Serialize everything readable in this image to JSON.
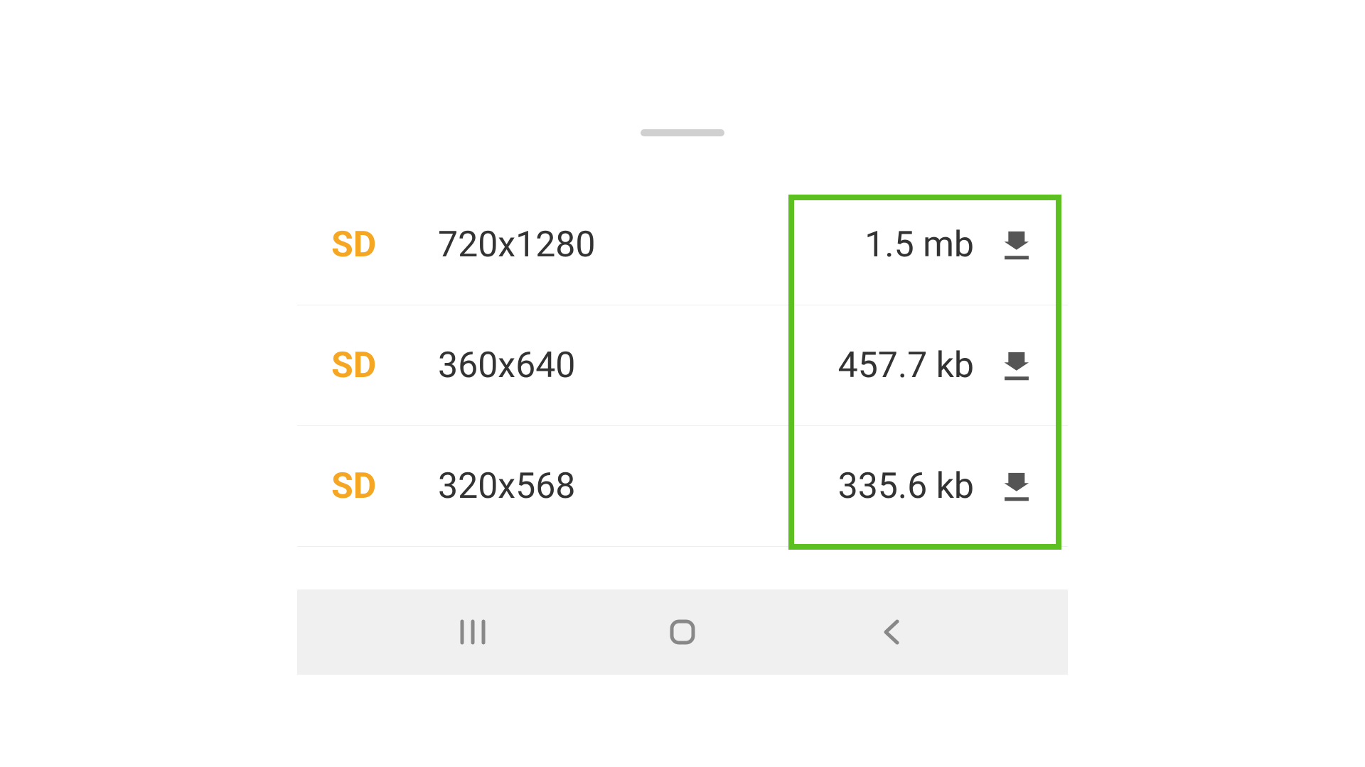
{
  "colors": {
    "badge": "#f5a623",
    "text": "#333333",
    "icon": "#666666",
    "highlight": "#5cc020"
  },
  "options": [
    {
      "quality": "SD",
      "resolution": "720x1280",
      "size": "1.5 mb"
    },
    {
      "quality": "SD",
      "resolution": "360x640",
      "size": "457.7 kb"
    },
    {
      "quality": "SD",
      "resolution": "320x568",
      "size": "335.6 kb"
    }
  ]
}
